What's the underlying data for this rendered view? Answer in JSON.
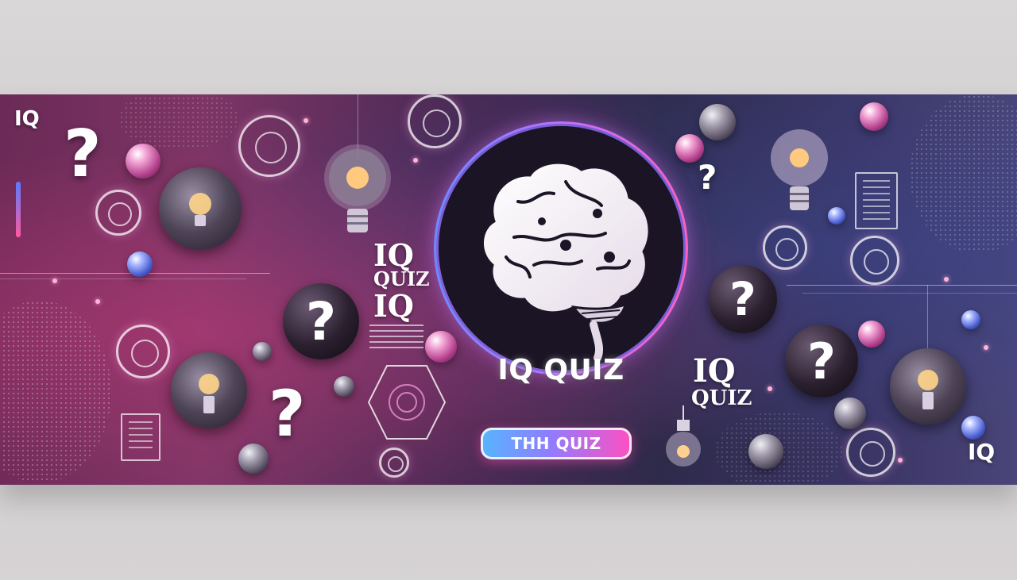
{
  "banner": {
    "main_title": "IQ QUIZ",
    "cta_label": "THH QUIZ",
    "labels": {
      "top_left_iq": "IQ",
      "mid_left_iq": "IQ",
      "mid_left_quiz": "QUIZ",
      "mid_left_iq2": "IQ",
      "right_iq": "IQ",
      "right_quiz": "QUIZ",
      "bottom_right_iq": "IQ"
    },
    "question_mark": "?",
    "colors": {
      "accent_pink": "#ff4fc0",
      "accent_blue": "#56b6ff",
      "background_start": "#6b2a57",
      "background_end": "#4a4578"
    }
  }
}
